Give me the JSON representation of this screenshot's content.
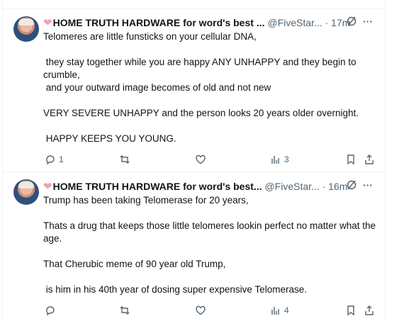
{
  "posts": [
    {
      "heart": "❤",
      "author_name": "HOME TRUTH HARDWARE for word's best ...",
      "handle": "@FiveStar...",
      "time": "· 17m",
      "body": "Telomeres are little funsticks on your cellular DNA,\n\n they stay together while you are happy ANY UNHAPPY and they begin to crumble,\n and your outward image becomes of old and not new\n\nVERY SEVERE UNHAPPY and the person looks 20 years older overnight.\n\n HAPPY KEEPS YOU YOUNG.",
      "reply_count": "1",
      "view_count": "3"
    },
    {
      "heart": "❤",
      "author_name": "HOME TRUTH HARDWARE for word's best...",
      "handle": "@FiveStar...",
      "time": "· 16m",
      "body": "Trump has been taking Telomerase for 20 years,\n\nThats a drug that keeps those little telomeres lookin perfect no matter what the age.\n\nThat Cherubic meme of 90 year old Trump,\n\n is him in his 40th year of dosing super expensive Telomerase.",
      "reply_count": "",
      "view_count": "4"
    }
  ],
  "more_label": "···",
  "icons": [
    "grok-icon",
    "more-icon",
    "reply-icon",
    "repost-icon",
    "like-icon",
    "views-icon",
    "bookmark-icon",
    "share-icon"
  ]
}
